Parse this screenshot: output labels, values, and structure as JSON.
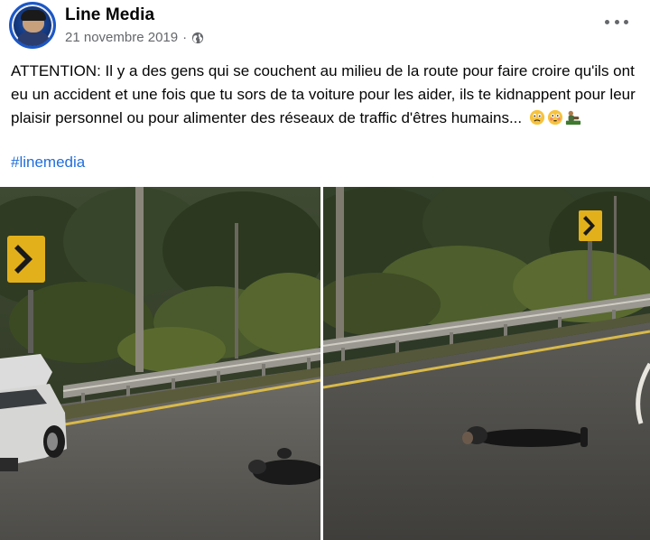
{
  "post": {
    "author": "Line Media",
    "date": "21 novembre 2019",
    "separator": "·",
    "text": "ATTENTION: Il y a des gens qui se couchent au milieu de la route pour faire croire qu'ils ont eu un accident et une fois que tu sors de ta voiture pour les aider, ils te kidnappent pour leur plaisir personnel ou pour alimenter des réseaux de traffic d'êtres humains...",
    "emojis": [
      "worried-face",
      "flushed-face",
      "person-lying-emoji"
    ],
    "hashtag": "#linemedia"
  },
  "icons": {
    "visibility": "globe-icon",
    "menu": "more-options-icon"
  },
  "colors": {
    "link": "#216fdb",
    "meta": "#65676b",
    "text": "#050505"
  }
}
